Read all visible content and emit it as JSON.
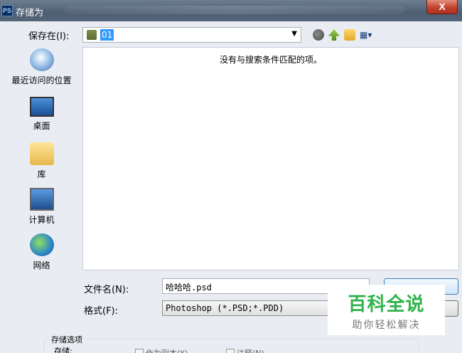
{
  "window": {
    "app_icon": "PS",
    "title": "存储为",
    "close_label": "X"
  },
  "savein": {
    "label": "保存在(I):",
    "value": "01"
  },
  "toolbar": {
    "icons": [
      "back-icon",
      "up-folder-icon",
      "new-folder-icon",
      "view-menu-icon"
    ],
    "view_glyph": "▦▾"
  },
  "places": [
    {
      "label": "最近访问的位置",
      "icon": "recent-places-icon"
    },
    {
      "label": "桌面",
      "icon": "desktop-icon"
    },
    {
      "label": "库",
      "icon": "library-icon"
    },
    {
      "label": "计算机",
      "icon": "computer-icon"
    },
    {
      "label": "网络",
      "icon": "network-icon"
    }
  ],
  "filelist": {
    "empty_message": "没有与搜索条件匹配的项。"
  },
  "filename": {
    "label": "文件名(N):",
    "value": "哈哈哈.psd"
  },
  "format": {
    "label": "格式(F):",
    "value": "Photoshop (*.PSD;*.PDD)"
  },
  "options": {
    "group_title": "存储选项",
    "save_label": "存储:",
    "as_copy": "作为副本(Y)",
    "notes": "注释(N)"
  },
  "watermark": {
    "brand": "百科全说",
    "slogan": "助你轻松解决"
  }
}
